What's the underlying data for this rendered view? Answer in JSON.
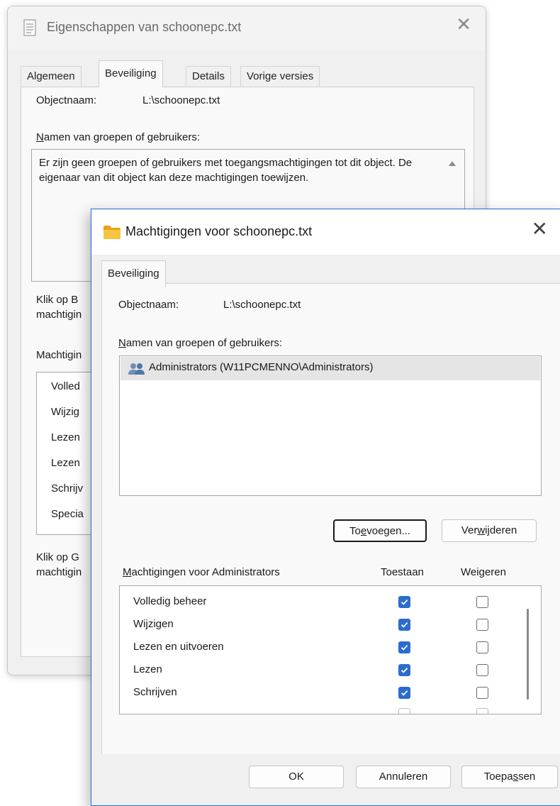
{
  "back_dialog": {
    "title": "Eigenschappen van schoonepc.txt",
    "tabs": [
      {
        "label": "Algemeen",
        "active": false
      },
      {
        "label": "Beveiliging",
        "active": true
      },
      {
        "label": "Details",
        "active": false
      },
      {
        "label": "Vorige versies",
        "active": false
      }
    ],
    "object_label": "Objectnaam:",
    "object_value": "L:\\schoonepc.txt",
    "groups_label_first": "N",
    "groups_label_rest": "amen van groepen of gebruikers:",
    "info_text": "Er zijn geen groepen of gebruikers met toegangsmachtigingen tot dit object. De eigenaar van dit object kan deze machtigingen toewijzen.",
    "click_text_1a": "Klik op B",
    "click_text_1b": "machtigin",
    "perm_label": "Machtigin",
    "perm_items": [
      "Volled",
      "Wijzig",
      "Lezen",
      "Lezen",
      "Schrijv",
      "Specia"
    ],
    "click_text_2a": "Klik op G",
    "click_text_2b": "machtigin"
  },
  "front_dialog": {
    "title": "Machtigingen voor schoonepc.txt",
    "tab": "Beveiliging",
    "object_label": "Objectnaam:",
    "object_value": "L:\\schoonepc.txt",
    "groups_label_first": "N",
    "groups_label_rest": "amen van groepen of gebruikers:",
    "users": [
      {
        "name": "Administrators (W11PCMENNO\\Administrators)",
        "selected": true
      }
    ],
    "add_button": {
      "pre": "To",
      "u": "e",
      "post": "voegen..."
    },
    "remove_button": {
      "pre": "Ver",
      "u": "w",
      "post": "ijderen"
    },
    "perms_header_first": "M",
    "perms_header_rest": "achtigingen voor Administrators",
    "allow_header": "Toestaan",
    "deny_header": "Weigeren",
    "permissions": [
      {
        "name": "Volledig beheer",
        "allow": true,
        "deny": false
      },
      {
        "name": "Wijzigen",
        "allow": true,
        "deny": false
      },
      {
        "name": "Lezen en uitvoeren",
        "allow": true,
        "deny": false
      },
      {
        "name": "Lezen",
        "allow": true,
        "deny": false
      },
      {
        "name": "Schrijven",
        "allow": true,
        "deny": false
      }
    ],
    "ok_button": "OK",
    "cancel_button": "Annuleren",
    "apply_button": {
      "pre": "Toepa",
      "u": "s",
      "post": "sen"
    }
  },
  "colors": {
    "accent": "#2b6ccf",
    "front_border": "#1f6fd6",
    "folder": "#f0b429"
  }
}
